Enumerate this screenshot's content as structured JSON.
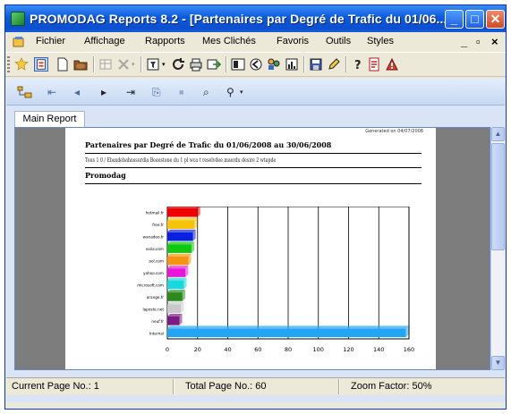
{
  "window": {
    "title": "PROMODAG Reports 8.2 - [Partenaires par Degré de Trafic du 01/06...",
    "controls": {
      "minimize": "_",
      "maximize": "□",
      "close": "✕"
    }
  },
  "menubar": {
    "items": [
      "Fichier",
      "Affichage",
      "Rapports",
      "Mes Clichés",
      "Favoris",
      "Outils",
      "Styles"
    ],
    "mdi_controls": [
      "_",
      "▫",
      "×"
    ]
  },
  "toolbar": {
    "icons": [
      "new-report-icon",
      "open-report-icon",
      "new-page-icon",
      "open-folder-icon",
      "table-icon",
      "delete-icon",
      "filter-icon",
      "refresh-icon",
      "print-icon",
      "export-icon",
      "grid-icon",
      "back-icon",
      "users-icon",
      "chart-icon",
      "save-icon",
      "edit-icon",
      "help-icon",
      "pdf-icon",
      "alert-icon"
    ]
  },
  "viewer_toolbar": {
    "icons": [
      "tree-toggle-icon",
      "first-page-icon",
      "previous-page-icon",
      "next-page-icon",
      "last-page-icon",
      "goto-page-icon",
      "stop-icon",
      "search-icon",
      "zoom-icon"
    ],
    "glyphs": [
      "⇤",
      "◂",
      "▸",
      "⇥",
      "⎘",
      "■",
      "⌕",
      "⚲"
    ]
  },
  "tabs": [
    "Main Report"
  ],
  "report": {
    "title": "Partenaires par Degré de Trafic du 01/06/2008 au 30/06/2008",
    "subtitle": "Tous 1 0 / Ebaxdebahnssurdia Beaestone du 1 pl wca t reselvdee maerdu desire 2 wtapde",
    "section": "Promodag",
    "corner_text": "Generated on 04/07/2008"
  },
  "chart_data": {
    "type": "bar",
    "orientation": "horizontal",
    "categories": [
      "hotmail.fr",
      "free.fr",
      "wanadoo.fr",
      "voila.com",
      "aol.com",
      "yahoo.com",
      "microsoft.com",
      "orange.fr",
      "laposte.net",
      "neuf.fr",
      "Internal"
    ],
    "values": [
      20,
      18,
      17,
      16,
      14,
      12,
      11,
      10,
      9,
      8,
      158
    ],
    "colors": [
      "#f20000",
      "#f5c40a",
      "#0a20e0",
      "#10c810",
      "#f59410",
      "#e816d8",
      "#18d8e0",
      "#2a8a1c",
      "#c9c9c9",
      "#7a1c84",
      "#22a5f2"
    ],
    "xlim": [
      0,
      160
    ],
    "xticks": [
      0,
      20,
      40,
      60,
      80,
      100,
      120,
      140,
      160
    ],
    "grid": true
  },
  "status": {
    "current_page": "Current Page No.: 1",
    "total_page": "Total Page No.: 60",
    "zoom": "Zoom Factor: 50%"
  }
}
